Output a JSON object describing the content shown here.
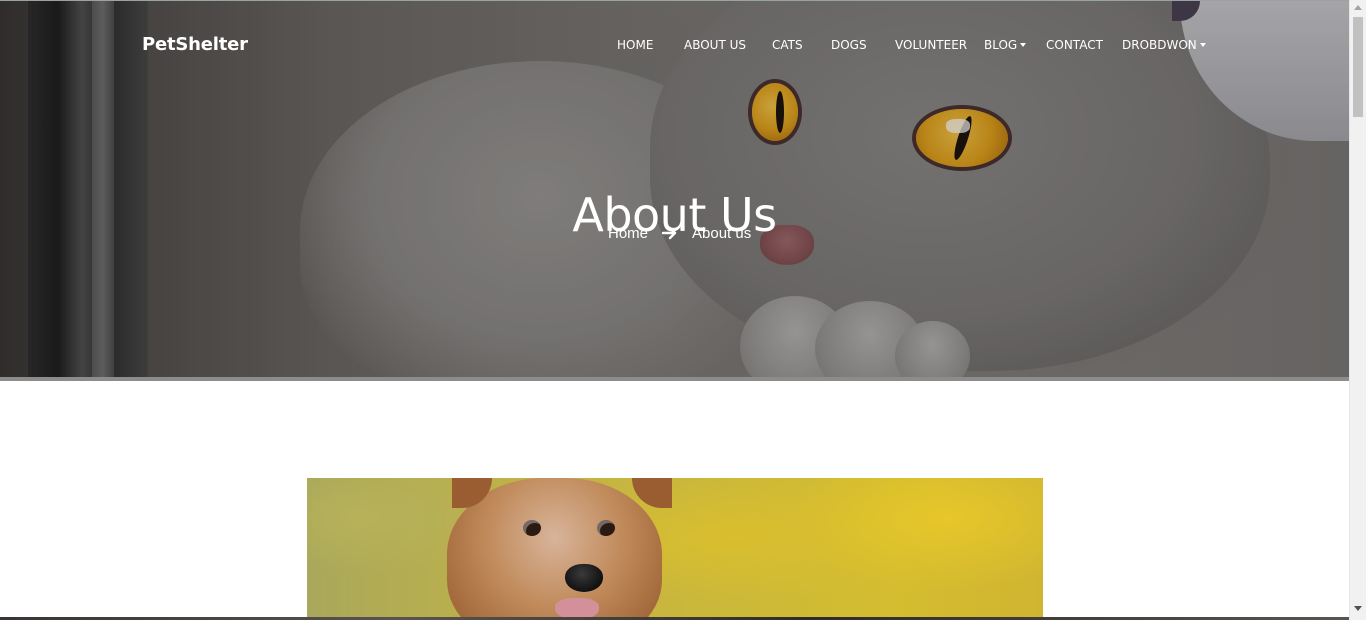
{
  "brand": {
    "name": "PetShelter"
  },
  "nav": {
    "items": [
      {
        "label": "HOME"
      },
      {
        "label": "ABOUT US"
      },
      {
        "label": "CATS"
      },
      {
        "label": "DOGS"
      },
      {
        "label": "VOLUNTEER"
      },
      {
        "label": "BLOG",
        "dropdown": true
      },
      {
        "label": "CONTACT"
      },
      {
        "label": "DROBDWON",
        "dropdown": true
      }
    ]
  },
  "hero": {
    "title": "About Us",
    "breadcrumb": {
      "home": "Home",
      "separator_icon": "arrow-right-icon",
      "current": "About us"
    }
  },
  "content": {
    "image_subject": "yorkshire terrier dog"
  }
}
